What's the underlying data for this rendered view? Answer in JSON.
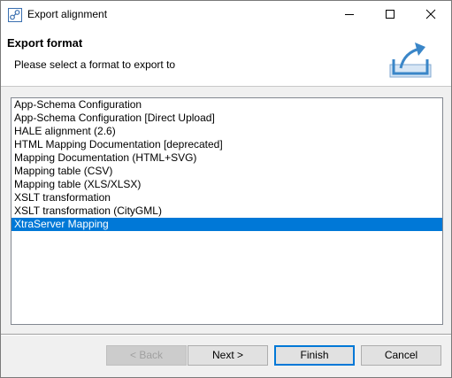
{
  "window": {
    "title": "Export alignment"
  },
  "header": {
    "title": "Export format",
    "description": "Please select a format to export to"
  },
  "formats": [
    "App-Schema Configuration",
    "App-Schema Configuration [Direct Upload]",
    "HALE alignment (2.6)",
    "HTML Mapping Documentation [deprecated]",
    "Mapping Documentation (HTML+SVG)",
    "Mapping table (CSV)",
    "Mapping table (XLS/XLSX)",
    "XSLT transformation",
    "XSLT transformation (CityGML)",
    "XtraServer Mapping"
  ],
  "selected_index": 9,
  "buttons": {
    "back": "< Back",
    "next": "Next >",
    "finish": "Finish",
    "cancel": "Cancel"
  },
  "colors": {
    "selection": "#0078d7",
    "export_icon": "#3a86c8"
  },
  "icons": [
    "app-icon",
    "minimize-icon",
    "maximize-icon",
    "close-icon",
    "export-icon"
  ]
}
